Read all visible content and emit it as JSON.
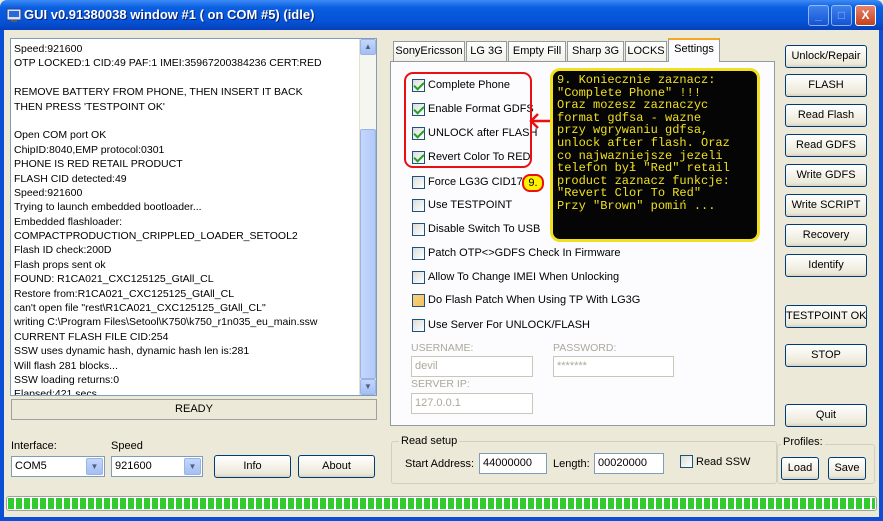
{
  "window": {
    "title": "GUI v0.91380038 window #1 ( on COM #5) (idle)",
    "controls": [
      "_",
      "□",
      "X"
    ]
  },
  "log": {
    "lines": [
      "Speed:921600",
      "OTP LOCKED:1 CID:49 PAF:1 IMEI:35967200384236 CERT:RED",
      "",
      "REMOVE BATTERY FROM PHONE, THEN INSERT IT BACK",
      "THEN PRESS 'TESTPOINT OK'",
      "",
      "Open COM port OK",
      "ChipID:8040,EMP protocol:0301",
      "PHONE IS RED RETAIL PRODUCT",
      "FLASH CID detected:49",
      "Speed:921600",
      "Trying to launch embedded bootloader...",
      "Embedded flashloader:",
      "COMPACTPRODUCTION_CRIPPLED_LOADER_SETOOL2",
      "Flash ID check:200D",
      "Flash props sent ok",
      "FOUND: R1CA021_CXC125125_GtAll_CL",
      "Restore from:R1CA021_CXC125125_GtAll_CL",
      "can't open file \"rest\\R1CA021_CXC125125_GtAll_CL\"",
      "writing C:\\Program Files\\Setool\\K750\\k750_r1n035_eu_main.ssw",
      "CURRENT FLASH FILE CID:254",
      "SSW uses dynamic hash, dynamic hash len is:281",
      "Will flash 281 blocks...",
      "SSW loading returns:0",
      "Elapsed:421 secs."
    ]
  },
  "status": {
    "text": "READY"
  },
  "connection": {
    "interface_label": "Interface:",
    "interface_value": "COM5",
    "speed_label": "Speed",
    "speed_value": "921600",
    "info_button": "Info",
    "about_button": "About"
  },
  "tabs": [
    "SonyEricsson",
    "LG 3G",
    "Empty Fill",
    "Sharp 3G",
    "LOCKS",
    "Settings"
  ],
  "settings": {
    "options": [
      {
        "label": "Complete Phone",
        "state": "checked"
      },
      {
        "label": "Enable Format GDFS",
        "state": "checked"
      },
      {
        "label": "UNLOCK after FLASH",
        "state": "checked"
      },
      {
        "label": "Revert Color To RED",
        "state": "checked"
      },
      {
        "label": "Force LG3G CID17",
        "state": "unchecked"
      },
      {
        "label": "Use TESTPOINT",
        "state": "unchecked"
      },
      {
        "label": "Disable Switch To USB",
        "state": "unchecked"
      },
      {
        "label": "Patch OTP<>GDFS Check In Firmware",
        "state": "unchecked"
      },
      {
        "label": "Allow To Change IMEI When Unlocking",
        "state": "unchecked"
      },
      {
        "label": "Do Flash Patch When Using TP With LG3G",
        "state": "partial"
      },
      {
        "label": "Use Server For UNLOCK/FLASH",
        "state": "unchecked"
      }
    ],
    "username_label": "USERNAME:",
    "username_value": "devil",
    "password_label": "PASSWORD:",
    "password_value": "*******",
    "server_label": "SERVER IP:",
    "server_value": "127.0.0.1"
  },
  "annotation": {
    "marker": "9.",
    "lines": [
      "9. Koniecznie zaznacz:",
      "   \"Complete Phone\" !!!",
      "  Oraz mozesz zaznaczyc",
      "format gdfsa - wazne",
      "przy wgrywaniu gdfsa,",
      "unlock after flash. Oraz",
      "co najwazniejsze jezeli",
      "telefon był \"Red\" retail",
      "product zaznacz funkcje:",
      "\"Revert Clor To Red\"",
      "Przy \"Brown\" pomiń ..."
    ],
    "arrow_color": "#e81010",
    "box_color": "#f0e020"
  },
  "read_setup": {
    "title": "Read setup",
    "start_label": "Start Address:",
    "start_value": "44000000",
    "length_label": "Length:",
    "length_value": "00020000",
    "read_ssw_label": "Read SSW"
  },
  "actions": {
    "unlock_repair": "Unlock/Repair",
    "flash": "FLASH",
    "read_flash": "Read Flash",
    "read_gdfs": "Read GDFS",
    "write_gdfs": "Write GDFS",
    "write_script": "Write SCRIPT",
    "recovery": "Recovery",
    "identify": "Identify",
    "testpoint_ok": "TESTPOINT OK",
    "stop": "STOP",
    "quit": "Quit"
  },
  "profiles": {
    "title": "Profiles:",
    "load": "Load",
    "save": "Save"
  },
  "progress": {
    "value": 1.0
  },
  "colors": {
    "titlebar": "#0553d8",
    "window_bg": "#ece9d8",
    "highlight_red": "#e81010",
    "annotation_yellow": "#f0e020",
    "progress_green": "#2fcb2f"
  }
}
